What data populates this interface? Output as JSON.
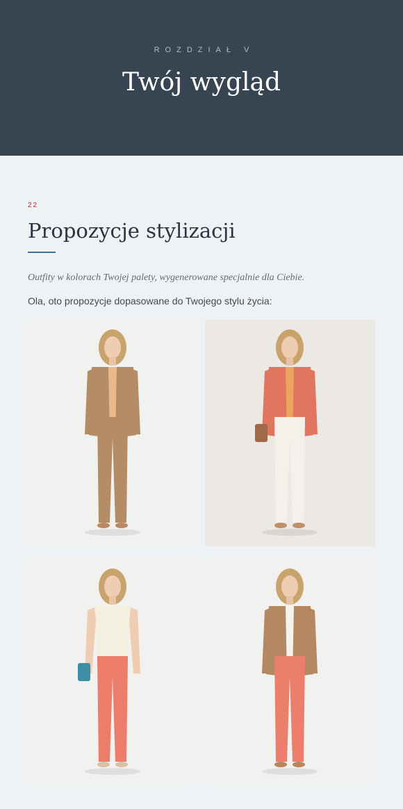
{
  "chapter": {
    "kicker": "ROZDZIAŁ V",
    "title": "Twój wygląd"
  },
  "section": {
    "number": "22",
    "title": "Propozycje stylizacji",
    "intro_italic": "Outfity w kolorach Twojej palety, wygenerowane specjalnie dla Ciebie.",
    "intro_text": "Ola, oto propozycje dopasowane do Twojego stylu życia:"
  },
  "outfits": [
    {
      "top": "#e9b98c",
      "jacket": "#b48c66",
      "bottom": "#b48c66",
      "shoes": "#b98a64",
      "bag": null
    },
    {
      "top": "#eba55e",
      "jacket": "#e07560",
      "bottom": "#f3f1ea",
      "shoes": "#c08f68",
      "bag": "#a0694a"
    },
    {
      "top": "#f4f0df",
      "jacket": null,
      "bottom": "#ec7d6a",
      "shoes": "#d9c1a6",
      "bag": "#3e8fa6"
    },
    {
      "top": "#f6f3ec",
      "jacket": "#b48860",
      "bottom": "#ec7f6c",
      "shoes": "#b9855b",
      "bag": null
    }
  ],
  "colors": {
    "hero_bg": "#374452",
    "page_bg": "#eff2f5",
    "accent_red": "#b3262f",
    "accent_blue": "#3f6f9a"
  }
}
